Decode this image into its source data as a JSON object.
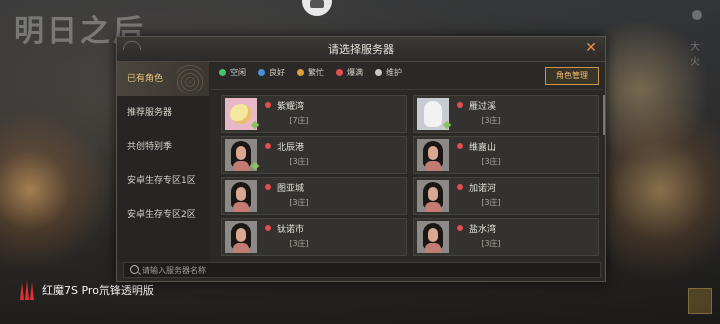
{
  "background": {
    "logo_text": "明日之后",
    "side_vertical_text": "大火",
    "footer_text": "",
    "brand_text": "红魔7S Pro氘锋透明版"
  },
  "dialog": {
    "title": "请选择服务器",
    "close_icon": "close-icon",
    "sidebar": {
      "items": [
        {
          "label": "已有角色",
          "active": true
        },
        {
          "label": "推荐服务器",
          "active": false
        },
        {
          "label": "共创特别季",
          "active": false
        },
        {
          "label": "安卓生存专区1区",
          "active": false
        },
        {
          "label": "安卓生存专区2区",
          "active": false
        }
      ]
    },
    "legend": [
      {
        "label": "空闲",
        "color": "#4cc070"
      },
      {
        "label": "良好",
        "color": "#4a90d8"
      },
      {
        "label": "繁忙",
        "color": "#e0a040"
      },
      {
        "label": "爆满",
        "color": "#e05050"
      },
      {
        "label": "维护",
        "color": "#c8c8c8"
      }
    ],
    "role_manage_label": "角色管理",
    "servers": [
      {
        "name": "紫耀湾",
        "count": "[7庄]",
        "avatar": "pink"
      },
      {
        "name": "雁过溪",
        "count": "[3庄]",
        "avatar": "white"
      },
      {
        "name": "北辰港",
        "count": "[3庄]",
        "avatar": "girl"
      },
      {
        "name": "维嘉山",
        "count": "[3庄]",
        "avatar": "girl"
      },
      {
        "name": "图亚城",
        "count": "[3庄]",
        "avatar": "girl"
      },
      {
        "name": "加诺河",
        "count": "[3庄]",
        "avatar": "girl"
      },
      {
        "name": "钛诺市",
        "count": "[3庄]",
        "avatar": "girl"
      },
      {
        "name": "盐水湾",
        "count": "[3庄]",
        "avatar": "girl"
      }
    ],
    "search": {
      "placeholder": "请输入服务器名称",
      "value": ""
    }
  }
}
